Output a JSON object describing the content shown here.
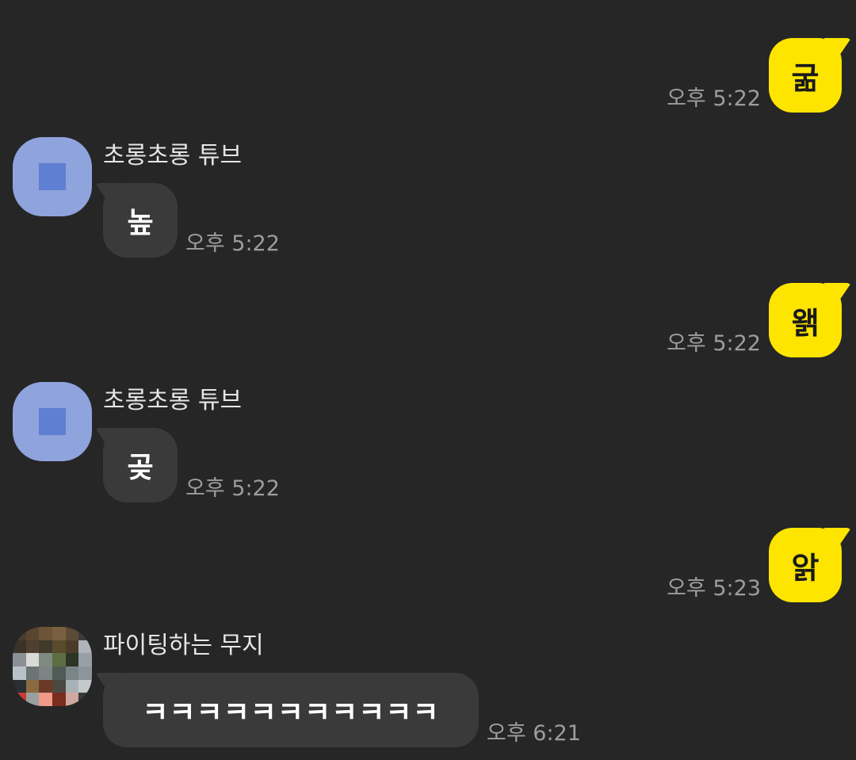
{
  "messages": [
    {
      "direction": "out",
      "text": "굶",
      "time": "오후 5:22"
    },
    {
      "direction": "in",
      "sender": "초롱초롱 튜브",
      "avatar": "blue-square",
      "text": "높",
      "time": "오후 5:22"
    },
    {
      "direction": "out",
      "text": "왥",
      "time": "오후 5:22"
    },
    {
      "direction": "in",
      "sender": "초롱초롱 튜브",
      "avatar": "blue-square",
      "text": "곶",
      "time": "오후 5:22"
    },
    {
      "direction": "out",
      "text": "앍",
      "time": "오후 5:23"
    },
    {
      "direction": "in",
      "sender": "파이팅하는 무지",
      "avatar": "pixelated-photo",
      "text": "ㅋㅋㅋㅋㅋㅋㅋㅋㅋㅋㅋ",
      "time": "오후 6:21"
    }
  ],
  "colors": {
    "background": "#262626",
    "outgoing_bubble": "#fee500",
    "incoming_bubble": "#3a3a3a",
    "default_avatar": "#8fa3dc",
    "timestamp": "#9d9d9d"
  }
}
